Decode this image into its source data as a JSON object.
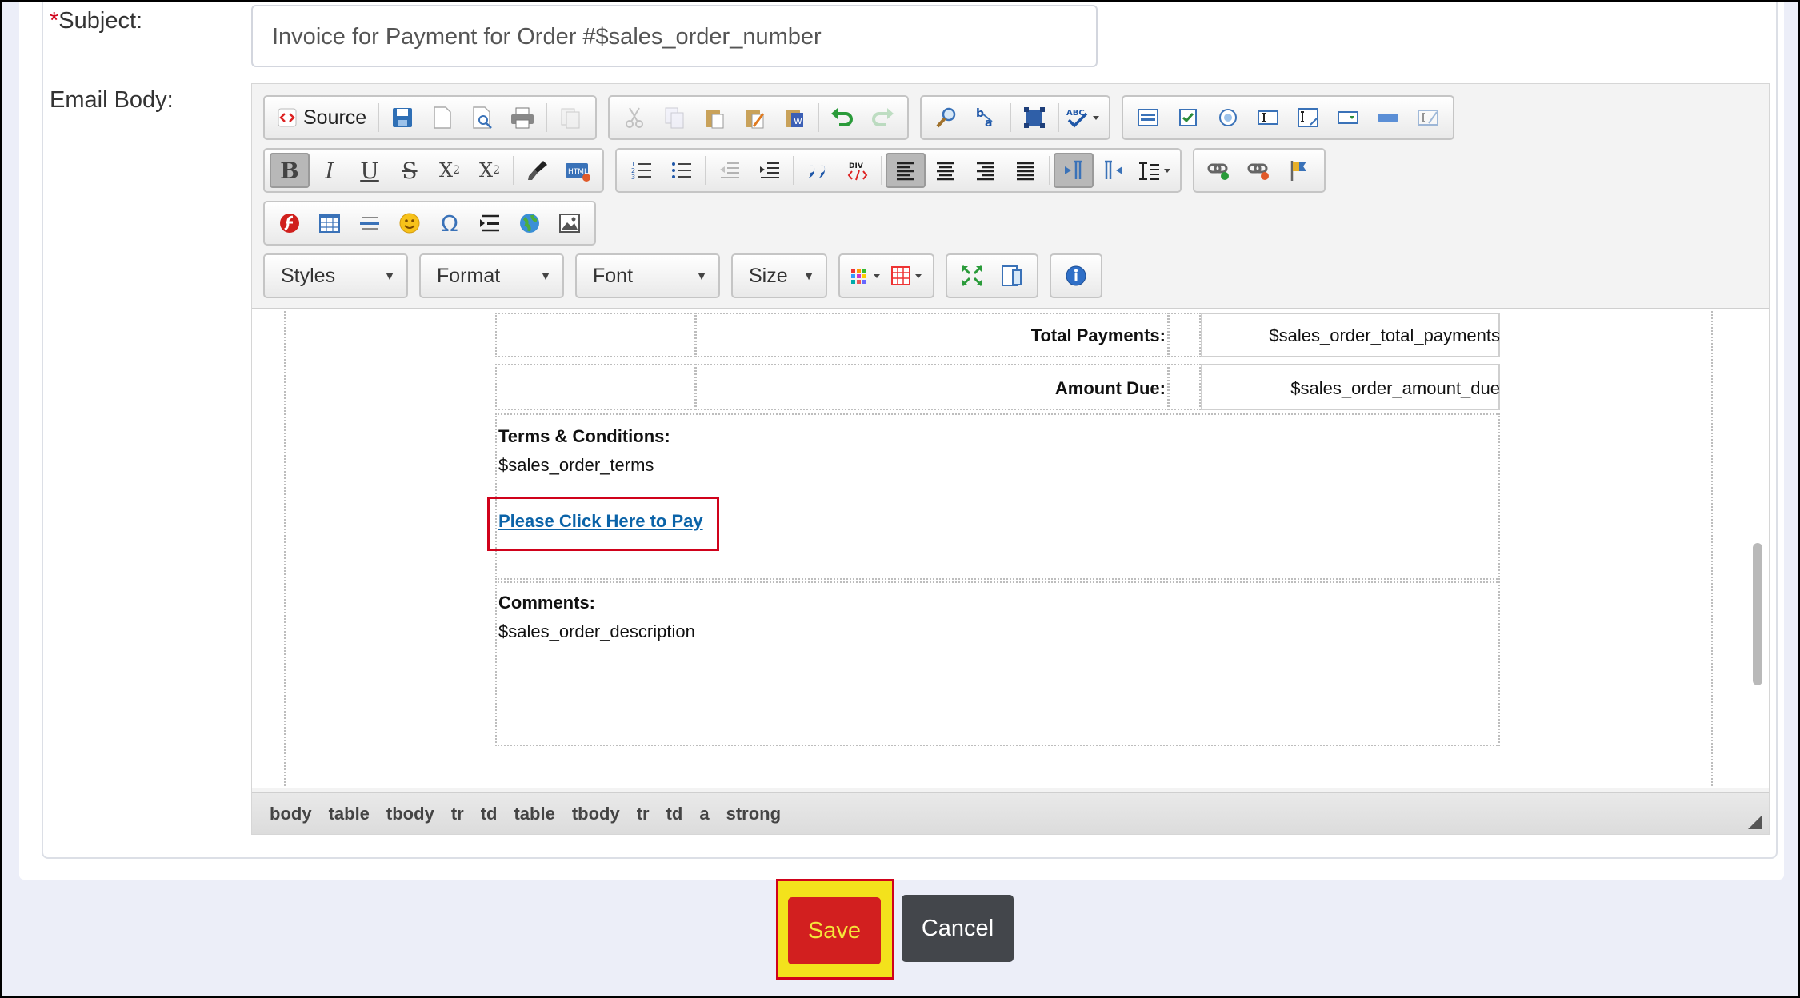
{
  "form": {
    "subject_required_mark": "*",
    "subject_label": "Subject:",
    "subject_value": "Invoice for Payment for Order #$sales_order_number",
    "email_body_label": "Email Body:"
  },
  "toolbar": {
    "source_label": "Source",
    "styles_label": "Styles",
    "format_label": "Format",
    "font_label": "Font",
    "size_label": "Size"
  },
  "content": {
    "total_payments_label": "Total Payments:",
    "total_payments_value": "$sales_order_total_payments",
    "amount_due_label": "Amount Due:",
    "amount_due_value": "$sales_order_amount_due",
    "terms_label": "Terms & Conditions:",
    "terms_value": "$sales_order_terms",
    "pay_link": "Please Click Here to Pay",
    "comments_label": "Comments:",
    "comments_value": "$sales_order_description"
  },
  "path": [
    "body",
    "table",
    "tbody",
    "tr",
    "td",
    "table",
    "tbody",
    "tr",
    "td",
    "a",
    "strong"
  ],
  "actions": {
    "save_label": "Save",
    "cancel_label": "Cancel"
  },
  "colors": {
    "save_bg": "#d21f1f",
    "save_text": "#f5e63a",
    "highlight_yellow": "#f3e21c",
    "highlight_red": "#d0021b",
    "cancel_bg": "#43464b",
    "link": "#0b63a8"
  }
}
